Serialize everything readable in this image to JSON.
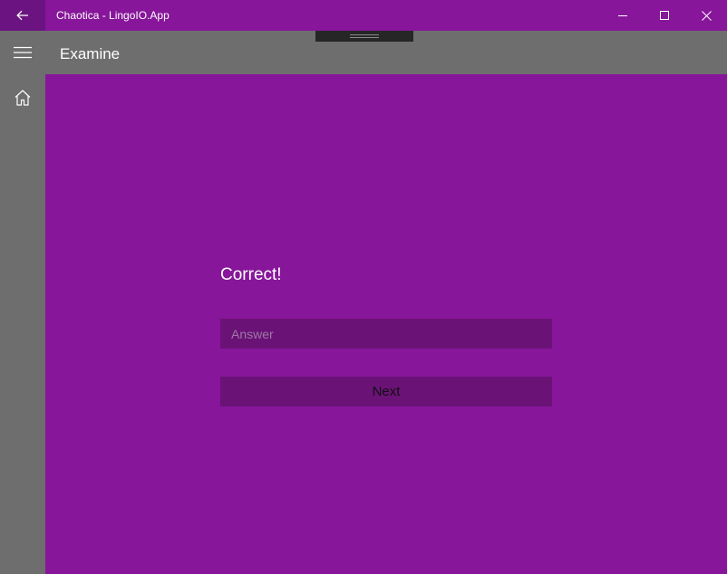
{
  "window": {
    "title": "Chaotica - LingoIO.App",
    "back_icon": "arrow-left-icon",
    "minimize_icon": "minimize-icon",
    "maximize_icon": "maximize-icon",
    "close_icon": "close-icon"
  },
  "header": {
    "menu_icon": "hamburger-icon",
    "page_title": "Examine"
  },
  "nav": {
    "items": [
      {
        "icon": "home-icon"
      }
    ]
  },
  "quiz": {
    "result_text": "Correct!",
    "answer_value": "",
    "answer_placeholder": "Answer",
    "next_label": "Next"
  },
  "colors": {
    "accent": "#87169a",
    "chrome": "#6e6e6e",
    "control": "#6b1277",
    "back_button": "#6b1380"
  }
}
